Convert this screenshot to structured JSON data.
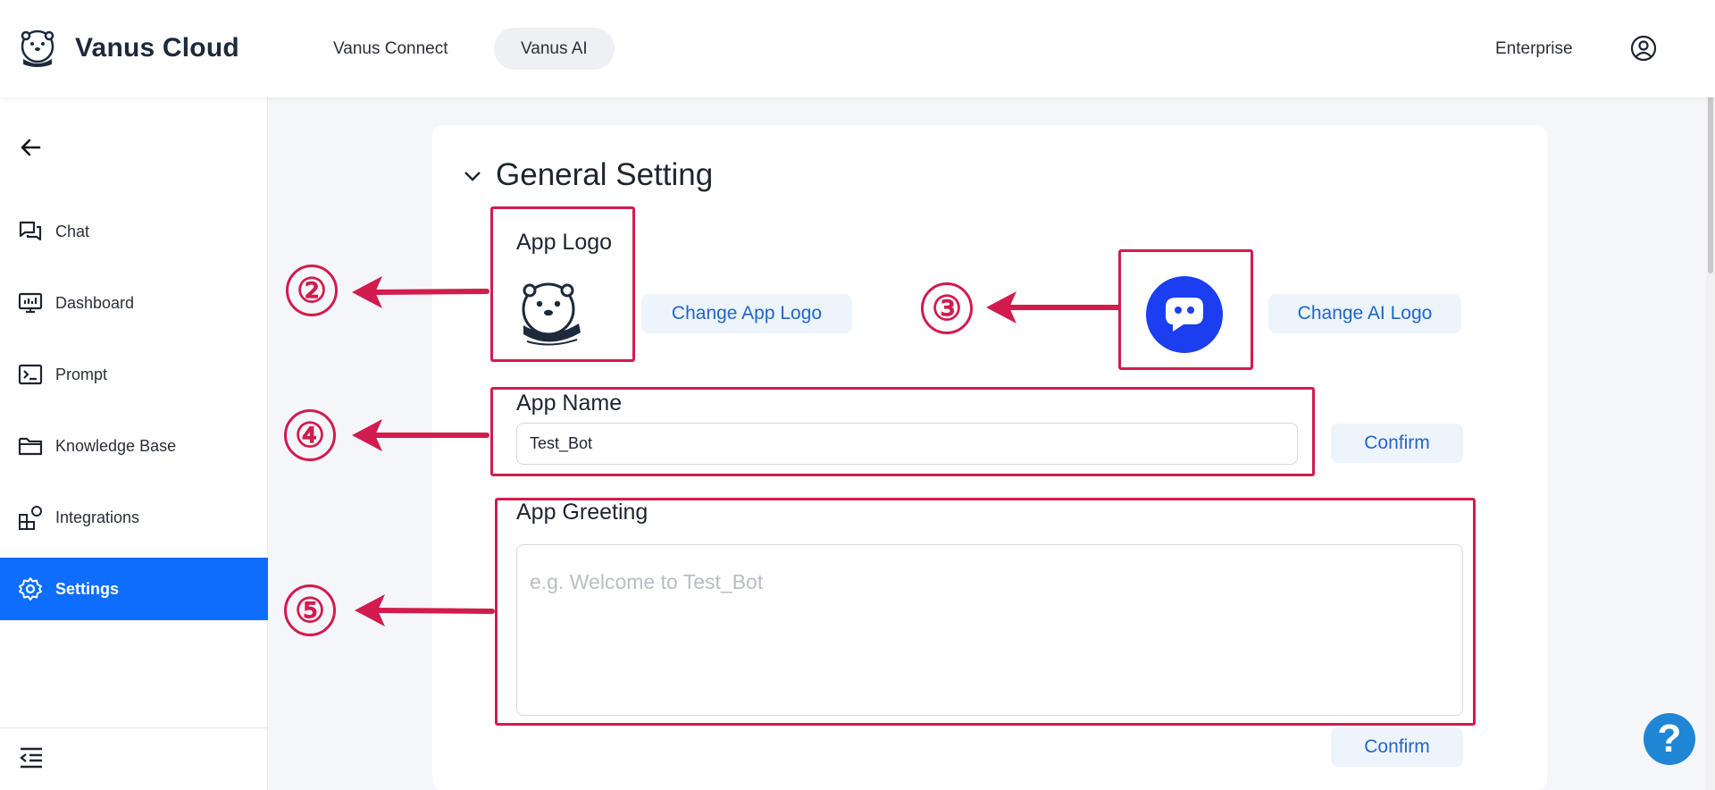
{
  "header": {
    "brand": "Vanus Cloud",
    "tabs": [
      {
        "label": "Vanus Connect",
        "active": false
      },
      {
        "label": "Vanus AI",
        "active": true
      }
    ],
    "enterprise_label": "Enterprise"
  },
  "sidebar": {
    "items": [
      {
        "label": "Chat",
        "icon": "chat-icon"
      },
      {
        "label": "Dashboard",
        "icon": "dashboard-icon"
      },
      {
        "label": "Prompt",
        "icon": "prompt-icon"
      },
      {
        "label": "Knowledge Base",
        "icon": "folder-icon"
      },
      {
        "label": "Integrations",
        "icon": "integrations-icon"
      },
      {
        "label": "Settings",
        "icon": "gear-icon",
        "active": true
      }
    ]
  },
  "main": {
    "section_title": "General Setting",
    "app_logo": {
      "label": "App Logo",
      "change_button": "Change App Logo"
    },
    "ai_logo": {
      "change_button": "Change AI Logo"
    },
    "app_name": {
      "label": "App Name",
      "value": "Test_Bot",
      "confirm_button": "Confirm"
    },
    "app_greeting": {
      "label": "App Greeting",
      "placeholder": "e.g. Welcome to Test_Bot",
      "confirm_button": "Confirm"
    }
  },
  "annotations": [
    "②",
    "③",
    "④",
    "⑤"
  ],
  "help": {
    "label": "?"
  },
  "colors": {
    "accent": "#0d6efd",
    "annotation": "#d21b4e",
    "ai_logo": "#1a3ef0",
    "button_bg": "#eef4fb",
    "button_text": "#1f66cc"
  }
}
